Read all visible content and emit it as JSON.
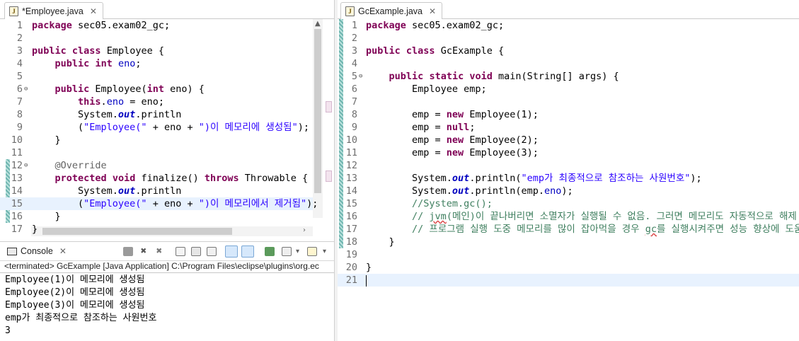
{
  "left_editor": {
    "tab": {
      "label": "*Employee.java",
      "icon": "java-file-icon"
    },
    "lines": [
      {
        "n": "1",
        "html": "<span class='kw'>package</span> sec05.exam02_gc;"
      },
      {
        "n": "2",
        "html": ""
      },
      {
        "n": "3",
        "html": "<span class='kw'>public</span> <span class='kw'>class</span> Employee {"
      },
      {
        "n": "4",
        "html": "    <span class='kw'>public</span> <span class='kw'>int</span> <span class='fld'>eno</span>;"
      },
      {
        "n": "5",
        "html": ""
      },
      {
        "n": "6",
        "html": "    <span class='kw'>public</span> Employee(<span class='kw'>int</span> eno) {"
      },
      {
        "n": "7",
        "html": "        <span class='kw'>this</span>.<span class='fld'>eno</span> = eno;"
      },
      {
        "n": "8",
        "html": "        System.<span class='stat'>out</span>.println"
      },
      {
        "n": "9",
        "html": "        (<span class='str'>\"Employee(\"</span> + eno + <span class='str'>\")이 메모리에 생성됨\"</span>);"
      },
      {
        "n": "10",
        "html": "    }"
      },
      {
        "n": "11",
        "html": ""
      },
      {
        "n": "12",
        "html": "    <span class='ann'>@Override</span>"
      },
      {
        "n": "13",
        "html": "    <span class='kw'>protected</span> <span class='kw'>void</span> finalize() <span class='kw'>throws</span> Throwable {"
      },
      {
        "n": "14",
        "html": "        System.<span class='stat'>out</span>.println"
      },
      {
        "n": "15",
        "html": "        (<span class='str'>\"Employee(\"</span> + eno + <span class='str'>\")이 메모리에서 제거됨\"</span>);"
      },
      {
        "n": "16",
        "html": "    }"
      },
      {
        "n": "17",
        "html": "}"
      }
    ]
  },
  "right_editor": {
    "tab": {
      "label": "GcExample.java",
      "icon": "java-file-icon"
    },
    "lines": [
      {
        "n": "1",
        "html": "<span class='kw'>package</span> sec05.exam02_gc;"
      },
      {
        "n": "2",
        "html": ""
      },
      {
        "n": "3",
        "html": "<span class='kw'>public</span> <span class='kw'>class</span> GcExample {"
      },
      {
        "n": "4",
        "html": ""
      },
      {
        "n": "5",
        "html": "    <span class='kw'>public</span> <span class='kw'>static</span> <span class='kw'>void</span> main(String[] args) {"
      },
      {
        "n": "6",
        "html": "        Employee emp;"
      },
      {
        "n": "7",
        "html": ""
      },
      {
        "n": "8",
        "html": "        emp = <span class='kw'>new</span> Employee(1);"
      },
      {
        "n": "9",
        "html": "        emp = <span class='kw'>null</span>;"
      },
      {
        "n": "10",
        "html": "        emp = <span class='kw'>new</span> Employee(2);"
      },
      {
        "n": "11",
        "html": "        emp = <span class='kw'>new</span> Employee(3);"
      },
      {
        "n": "12",
        "html": ""
      },
      {
        "n": "13",
        "html": "        System.<span class='stat'>out</span>.println(<span class='str'>\"emp가 최종적으로 참조하는 사원번호\"</span>);"
      },
      {
        "n": "14",
        "html": "        System.<span class='stat'>out</span>.println(emp.<span class='fld'>eno</span>);"
      },
      {
        "n": "15",
        "html": "        <span class='cmt'>//System.gc();</span>"
      },
      {
        "n": "16",
        "html": "        <span class='cmt'>// <span class='sq'>jvm</span>(메인)이 끝나버리면 소멸자가 실행될 수 없음. 그러면 메모리도 자동적으로 해제 됨.</span>"
      },
      {
        "n": "17",
        "html": "        <span class='cmt'>// 프로그램 실행 도중 메모리를 많이 잡아먹을 경우 <span class='sq'>gc</span>를 실행시켜주면 성능 향상에 도움이 됨.</span>"
      },
      {
        "n": "18",
        "html": "    }"
      },
      {
        "n": "19",
        "html": ""
      },
      {
        "n": "20",
        "html": "}"
      },
      {
        "n": "21",
        "html": ""
      }
    ]
  },
  "console": {
    "title": "Console",
    "terminated": "<terminated> GcExample [Java Application] C:\\Program Files\\eclipse\\plugins\\org.ec",
    "output": [
      "Employee(1)이 메모리에 생성됨",
      "Employee(2)이 메모리에 생성됨",
      "Employee(3)이 메모리에 생성됨",
      "emp가 최종적으로 참조하는 사원번호",
      "3"
    ]
  }
}
